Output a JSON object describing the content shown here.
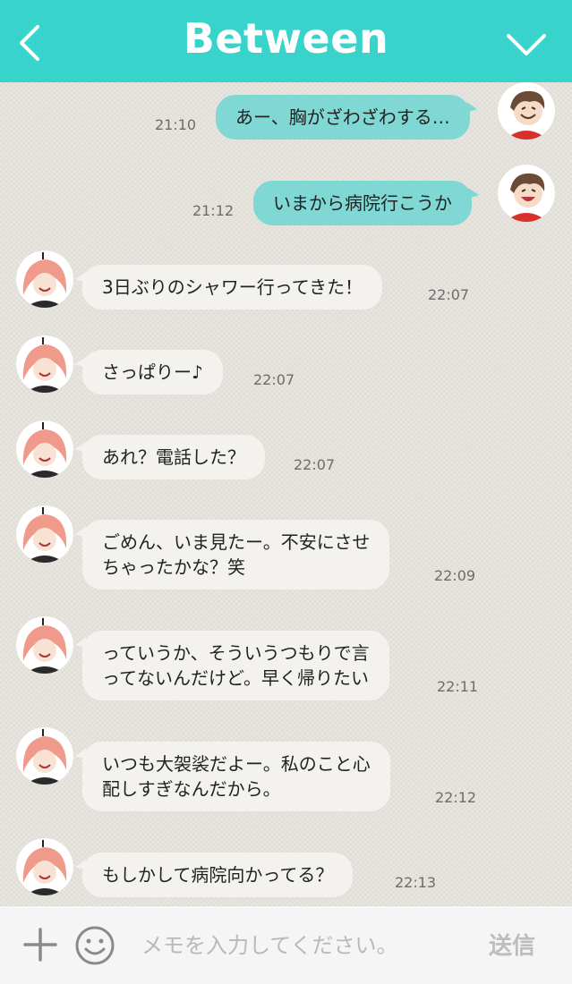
{
  "header": {
    "title": "Between",
    "back_icon": "chevron-left-icon",
    "menu_icon": "chevron-down-icon",
    "color": "#38d4cc"
  },
  "messages": [
    {
      "sender": "me",
      "text": "あー、胸がざわざわする…",
      "time": "21:10"
    },
    {
      "sender": "me",
      "text": "いまから病院行こうか",
      "time": "21:12"
    },
    {
      "sender": "partner",
      "lines": [
        "3日ぶりのシャワー行ってきた！"
      ],
      "time": "22:07"
    },
    {
      "sender": "partner",
      "lines": [
        "さっぱりー♪"
      ],
      "time": "22:07"
    },
    {
      "sender": "partner",
      "lines": [
        "あれ？電話した？"
      ],
      "time": "22:07"
    },
    {
      "sender": "partner",
      "lines": [
        "ごめん、いま見たー。不安にさせ",
        "ちゃったかな？笑"
      ],
      "time": "22:09"
    },
    {
      "sender": "partner",
      "lines": [
        "っていうか、そういうつもりで言",
        "ってないんだけど。早く帰りたい"
      ],
      "time": "22:11"
    },
    {
      "sender": "partner",
      "lines": [
        "いつも大袈裟だよー。私のこと心",
        "配しすぎなんだから。"
      ],
      "time": "22:12"
    },
    {
      "sender": "partner",
      "lines": [
        "もしかして病院向かってる？"
      ],
      "time": "22:13"
    }
  ],
  "input_bar": {
    "placeholder": "メモを入力してください。",
    "send_label": "送信",
    "plus_icon": "plus-icon",
    "emoji_icon": "smiley-icon"
  },
  "colors": {
    "outgoing_bubble": "#80d8d4",
    "incoming_bubble": "#f3f2ef",
    "background": "#e4e2db"
  }
}
